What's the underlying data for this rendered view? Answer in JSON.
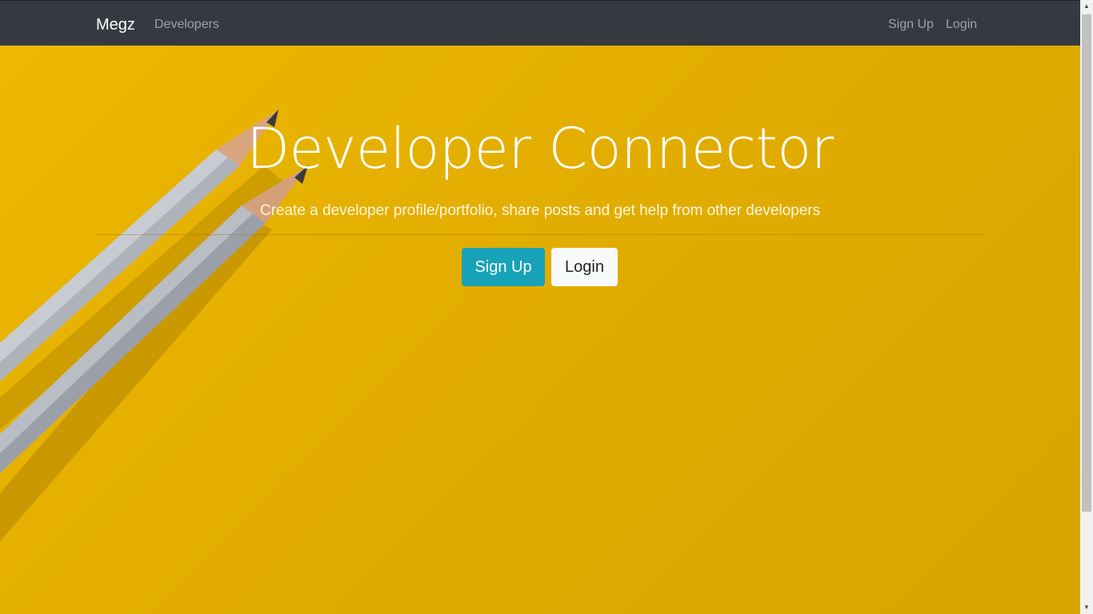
{
  "navbar": {
    "brand": "Megz",
    "links": {
      "developers": "Developers",
      "signup": "Sign Up",
      "login": "Login"
    },
    "background": "#343a40"
  },
  "hero": {
    "title": "Developer Connector",
    "subtitle": "Create a developer profile/portfolio, share posts and get help from other developers",
    "buttons": {
      "signup": "Sign Up",
      "login": "Login"
    },
    "background_color": "#e2ad00",
    "signup_color": "#17a2b8",
    "login_color": "#f8f9fa"
  },
  "scrollbar": {
    "up_icon": "scroll-up-arrow-icon",
    "down_icon": "scroll-down-arrow-icon"
  }
}
